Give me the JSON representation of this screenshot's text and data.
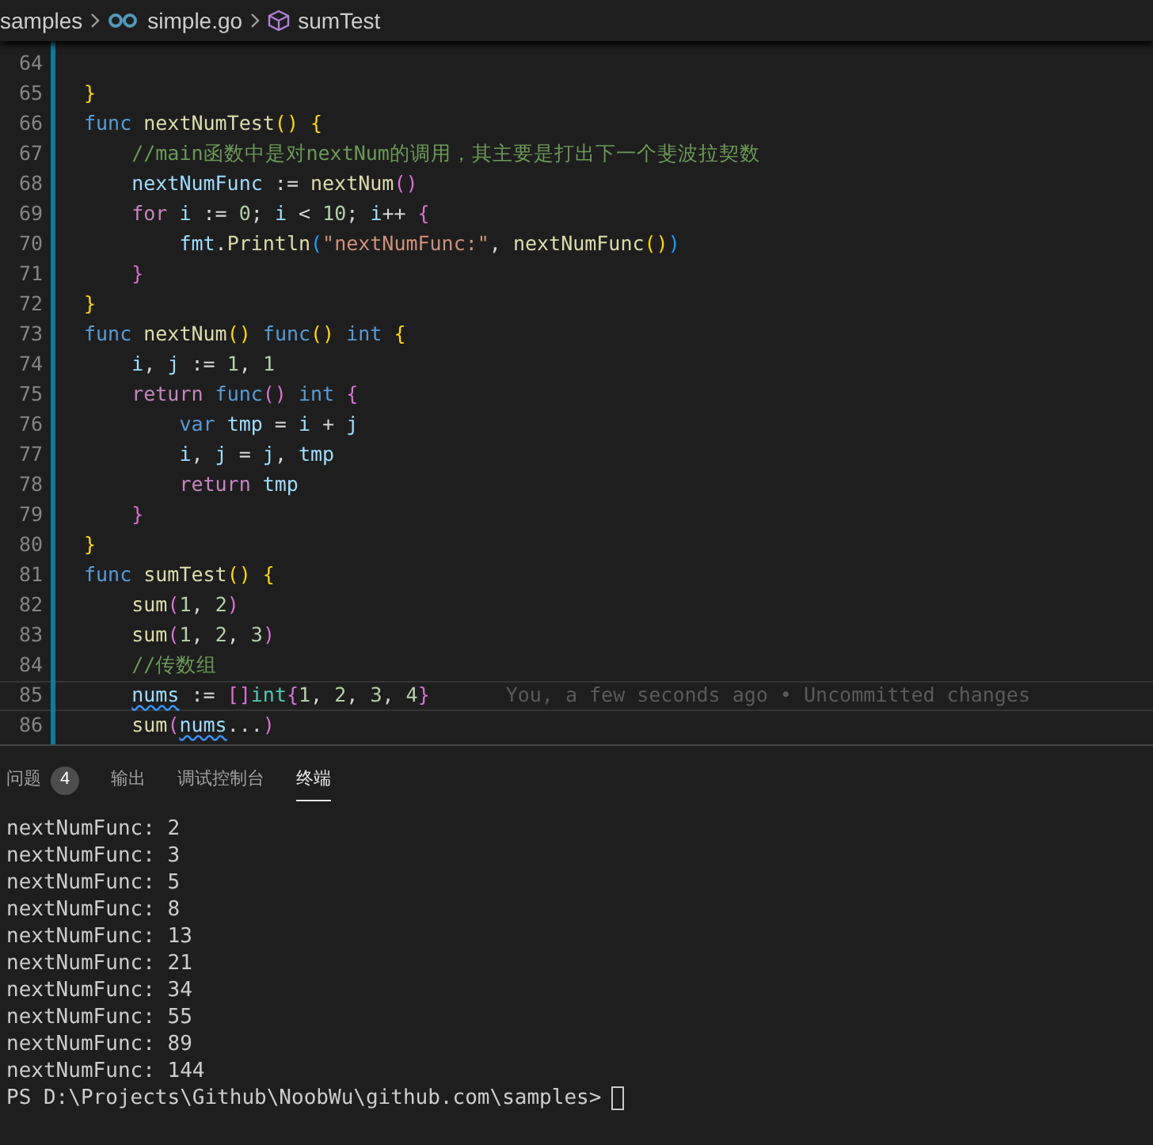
{
  "breadcrumb": [
    {
      "label": "samples",
      "kind": "folder"
    },
    {
      "label": "simple.go",
      "kind": "go-file"
    },
    {
      "label": "sumTest",
      "kind": "symbol"
    }
  ],
  "editor": {
    "lines": [
      {
        "number": "64"
      },
      {
        "number": "65",
        "tokens": [
          {
            "text": "}",
            "kind": "b1"
          }
        ]
      },
      {
        "number": "66",
        "tokens": [
          {
            "text": "func",
            "kind": "kw"
          },
          {
            "text": " nextNumTest",
            "kind": "fn"
          },
          {
            "text": "()",
            "kind": "b1"
          },
          {
            "text": " {",
            "kind": "b1"
          }
        ]
      },
      {
        "number": "67",
        "tokens": [
          {
            "text": "    //main函数中是对nextNum的调用，其主要是打出下一个斐波拉契数",
            "kind": "cmt"
          }
        ]
      },
      {
        "number": "68",
        "tokens": [
          {
            "text": "    nextNumFunc",
            "kind": "var"
          },
          {
            "text": " := ",
            "kind": "op"
          },
          {
            "text": "nextNum",
            "kind": "fn"
          },
          {
            "text": "()",
            "kind": "b2"
          }
        ]
      },
      {
        "number": "69",
        "tokens": [
          {
            "text": "    for",
            "kind": "ctl"
          },
          {
            "text": " i",
            "kind": "var"
          },
          {
            "text": " := ",
            "kind": "op"
          },
          {
            "text": "0",
            "kind": "num"
          },
          {
            "text": "; ",
            "kind": "op"
          },
          {
            "text": "i",
            "kind": "var"
          },
          {
            "text": " < ",
            "kind": "op"
          },
          {
            "text": "10",
            "kind": "num"
          },
          {
            "text": "; ",
            "kind": "op"
          },
          {
            "text": "i",
            "kind": "var"
          },
          {
            "text": "++ ",
            "kind": "op"
          },
          {
            "text": "{",
            "kind": "b2"
          }
        ]
      },
      {
        "number": "70",
        "tokens": [
          {
            "text": "        fmt",
            "kind": "var"
          },
          {
            "text": ".",
            "kind": "op"
          },
          {
            "text": "Println",
            "kind": "fn"
          },
          {
            "text": "(",
            "kind": "b3"
          },
          {
            "text": "\"nextNumFunc:\"",
            "kind": "str"
          },
          {
            "text": ", ",
            "kind": "op"
          },
          {
            "text": "nextNumFunc",
            "kind": "fn"
          },
          {
            "text": "()",
            "kind": "b1"
          },
          {
            "text": ")",
            "kind": "b3"
          }
        ]
      },
      {
        "number": "71",
        "tokens": [
          {
            "text": "    }",
            "kind": "b2"
          }
        ]
      },
      {
        "number": "72",
        "tokens": [
          {
            "text": "}",
            "kind": "b1"
          }
        ]
      },
      {
        "number": "73",
        "tokens": [
          {
            "text": "func",
            "kind": "kw"
          },
          {
            "text": " nextNum",
            "kind": "fn"
          },
          {
            "text": "()",
            "kind": "b1"
          },
          {
            "text": " func",
            "kind": "kw"
          },
          {
            "text": "()",
            "kind": "b1"
          },
          {
            "text": " int",
            "kind": "kw"
          },
          {
            "text": " {",
            "kind": "b1"
          }
        ]
      },
      {
        "number": "74",
        "tokens": [
          {
            "text": "    i",
            "kind": "var"
          },
          {
            "text": ", ",
            "kind": "op"
          },
          {
            "text": "j",
            "kind": "var"
          },
          {
            "text": " := ",
            "kind": "op"
          },
          {
            "text": "1",
            "kind": "num"
          },
          {
            "text": ", ",
            "kind": "op"
          },
          {
            "text": "1",
            "kind": "num"
          }
        ]
      },
      {
        "number": "75",
        "tokens": [
          {
            "text": "    return",
            "kind": "ctl"
          },
          {
            "text": " func",
            "kind": "kw"
          },
          {
            "text": "()",
            "kind": "b2"
          },
          {
            "text": " int",
            "kind": "kw"
          },
          {
            "text": " {",
            "kind": "b2"
          }
        ]
      },
      {
        "number": "76",
        "tokens": [
          {
            "text": "        var",
            "kind": "kw"
          },
          {
            "text": " tmp",
            "kind": "var"
          },
          {
            "text": " = ",
            "kind": "op"
          },
          {
            "text": "i",
            "kind": "var"
          },
          {
            "text": " + ",
            "kind": "op"
          },
          {
            "text": "j",
            "kind": "var"
          }
        ]
      },
      {
        "number": "77",
        "tokens": [
          {
            "text": "        i",
            "kind": "var"
          },
          {
            "text": ", ",
            "kind": "op"
          },
          {
            "text": "j",
            "kind": "var"
          },
          {
            "text": " = ",
            "kind": "op"
          },
          {
            "text": "j",
            "kind": "var"
          },
          {
            "text": ", ",
            "kind": "op"
          },
          {
            "text": "tmp",
            "kind": "var"
          }
        ]
      },
      {
        "number": "78",
        "tokens": [
          {
            "text": "        return",
            "kind": "ctl"
          },
          {
            "text": " tmp",
            "kind": "var"
          }
        ]
      },
      {
        "number": "79",
        "tokens": [
          {
            "text": "    }",
            "kind": "b2"
          }
        ]
      },
      {
        "number": "80",
        "tokens": [
          {
            "text": "}",
            "kind": "b1"
          }
        ]
      },
      {
        "number": "81",
        "tokens": [
          {
            "text": "func",
            "kind": "kw"
          },
          {
            "text": " sumTest",
            "kind": "fn"
          },
          {
            "text": "()",
            "kind": "b1"
          },
          {
            "text": " {",
            "kind": "b1"
          }
        ]
      },
      {
        "number": "82",
        "tokens": [
          {
            "text": "    sum",
            "kind": "fn"
          },
          {
            "text": "(",
            "kind": "b2"
          },
          {
            "text": "1",
            "kind": "num"
          },
          {
            "text": ", ",
            "kind": "op"
          },
          {
            "text": "2",
            "kind": "num"
          },
          {
            "text": ")",
            "kind": "b2"
          }
        ]
      },
      {
        "number": "83",
        "tokens": [
          {
            "text": "    sum",
            "kind": "fn"
          },
          {
            "text": "(",
            "kind": "b2"
          },
          {
            "text": "1",
            "kind": "num"
          },
          {
            "text": ", ",
            "kind": "op"
          },
          {
            "text": "2",
            "kind": "num"
          },
          {
            "text": ", ",
            "kind": "op"
          },
          {
            "text": "3",
            "kind": "num"
          },
          {
            "text": ")",
            "kind": "b2"
          }
        ]
      },
      {
        "number": "84",
        "tokens": [
          {
            "text": "    //传数组",
            "kind": "cmt"
          }
        ]
      },
      {
        "number": "85",
        "current": true,
        "blame": "You, a few seconds ago • Uncommitted changes",
        "tokens": [
          {
            "text": "    nums",
            "kind": "var-warn"
          },
          {
            "text": " := ",
            "kind": "op"
          },
          {
            "text": "[]",
            "kind": "b2"
          },
          {
            "text": "int",
            "kind": "type"
          },
          {
            "text": "{",
            "kind": "b2"
          },
          {
            "text": "1",
            "kind": "num"
          },
          {
            "text": ", ",
            "kind": "op"
          },
          {
            "text": "2",
            "kind": "num"
          },
          {
            "text": ", ",
            "kind": "op"
          },
          {
            "text": "3",
            "kind": "num"
          },
          {
            "text": ", ",
            "kind": "op"
          },
          {
            "text": "4",
            "kind": "num"
          },
          {
            "text": "}",
            "kind": "b2"
          }
        ]
      },
      {
        "number": "86",
        "tokens": [
          {
            "text": "    sum",
            "kind": "fn"
          },
          {
            "text": "(",
            "kind": "b2"
          },
          {
            "text": "nums",
            "kind": "var-warn"
          },
          {
            "text": "...",
            "kind": "op"
          },
          {
            "text": ")",
            "kind": "b2"
          }
        ]
      }
    ]
  },
  "panel": {
    "tabs": [
      {
        "label": "问题",
        "badge": "4",
        "selected": false
      },
      {
        "label": "输出",
        "selected": false
      },
      {
        "label": "调试控制台",
        "selected": false
      },
      {
        "label": "终端",
        "selected": true
      }
    ],
    "terminal_lines": [
      "nextNumFunc: 2",
      "nextNumFunc: 3",
      "nextNumFunc: 5",
      "nextNumFunc: 8",
      "nextNumFunc: 13",
      "nextNumFunc: 21",
      "nextNumFunc: 34",
      "nextNumFunc: 55",
      "nextNumFunc: 89",
      "nextNumFunc: 144"
    ],
    "prompt": "PS D:\\Projects\\Github\\NoobWu\\github.com\\samples>"
  }
}
